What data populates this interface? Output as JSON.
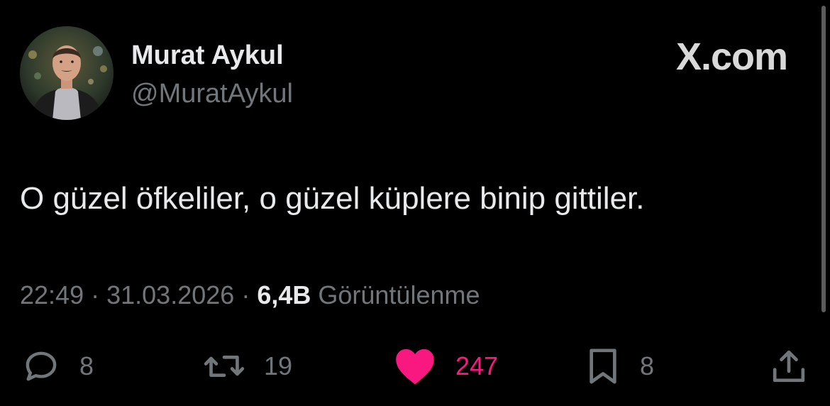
{
  "author": {
    "display_name": "Murat Aykul",
    "handle": "@MuratAykul"
  },
  "brand": "X.com",
  "tweet": {
    "text": "O güzel öfkeliler, o güzel küplere binip gittiler."
  },
  "meta": {
    "time": "22:49",
    "separator": "·",
    "date": "31.03.2026",
    "views_count": "6,4B",
    "views_label": "Görüntülenme"
  },
  "actions": {
    "reply": {
      "icon": "reply-icon",
      "count": "8"
    },
    "repost": {
      "icon": "repost-icon",
      "count": "19"
    },
    "like": {
      "icon": "heart-icon",
      "count": "247",
      "liked": true
    },
    "bookmark": {
      "icon": "bookmark-icon",
      "count": "8"
    },
    "share": {
      "icon": "share-icon"
    }
  },
  "colors": {
    "background": "#000000",
    "primary_text": "#e7e9ea",
    "secondary_text": "#71767b",
    "like": "#f91880"
  }
}
